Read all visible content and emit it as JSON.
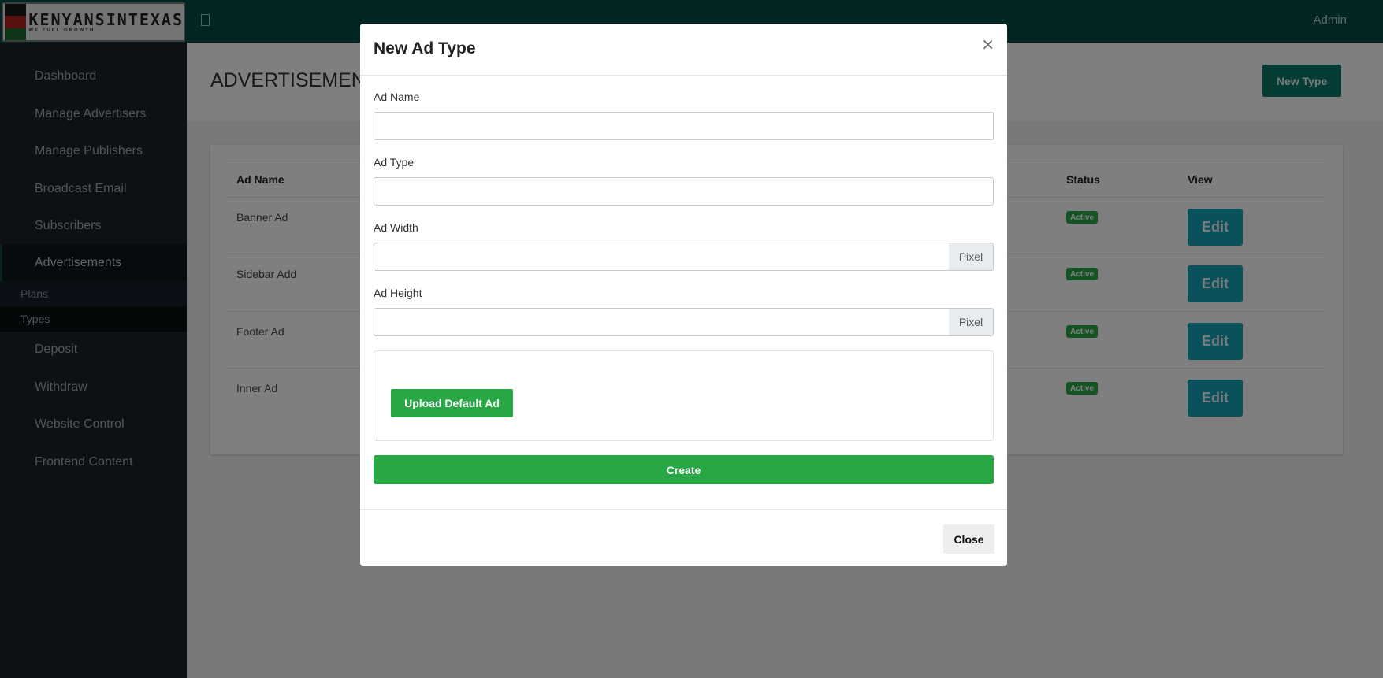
{
  "header": {
    "logo_name": "KENYANSINTEXAS",
    "logo_tagline": "WE FUEL GROWTH",
    "admin_label": "Admin"
  },
  "sidebar": {
    "items": [
      {
        "label": "Dashboard"
      },
      {
        "label": "Manage Advertisers"
      },
      {
        "label": "Manage Publishers"
      },
      {
        "label": "Broadcast Email"
      },
      {
        "label": "Subscribers"
      },
      {
        "label": "Advertisements",
        "active": true
      },
      {
        "label": "Deposit"
      },
      {
        "label": "Withdraw"
      },
      {
        "label": "Website Control"
      },
      {
        "label": "Frontend Content"
      }
    ],
    "subitems": [
      {
        "label": "Plans"
      },
      {
        "label": "Types",
        "active": true
      }
    ]
  },
  "page": {
    "title": "ADVERTISEMENT",
    "new_type_label": "New Type"
  },
  "table": {
    "headers": {
      "name": "Ad Name",
      "status": "Status",
      "view": "View"
    },
    "rows": [
      {
        "name": "Banner Ad",
        "status": "Active",
        "action": "Edit"
      },
      {
        "name": "Sidebar Add",
        "status": "Active",
        "action": "Edit"
      },
      {
        "name": "Footer Ad",
        "status": "Active",
        "action": "Edit"
      },
      {
        "name": "Inner Ad",
        "status": "Active",
        "action": "Edit"
      }
    ]
  },
  "modal": {
    "title": "New Ad Type",
    "close_symbol": "×",
    "fields": {
      "ad_name": {
        "label": "Ad Name",
        "value": ""
      },
      "ad_type": {
        "label": "Ad Type",
        "value": ""
      },
      "ad_width": {
        "label": "Ad Width",
        "value": "",
        "addon": "Pixel"
      },
      "ad_height": {
        "label": "Ad Height",
        "value": "",
        "addon": "Pixel"
      }
    },
    "upload_label": "Upload Default Ad",
    "create_label": "Create",
    "close_label": "Close"
  },
  "colors": {
    "topbar": "#014b45",
    "sidebar": "#182328",
    "primary_green": "#28a745",
    "info": "#17a2b8",
    "teal_button": "#0a7a6c"
  },
  "icons": {
    "menu_toggle": "menu-toggle-icon",
    "modal_close": "close-icon"
  }
}
